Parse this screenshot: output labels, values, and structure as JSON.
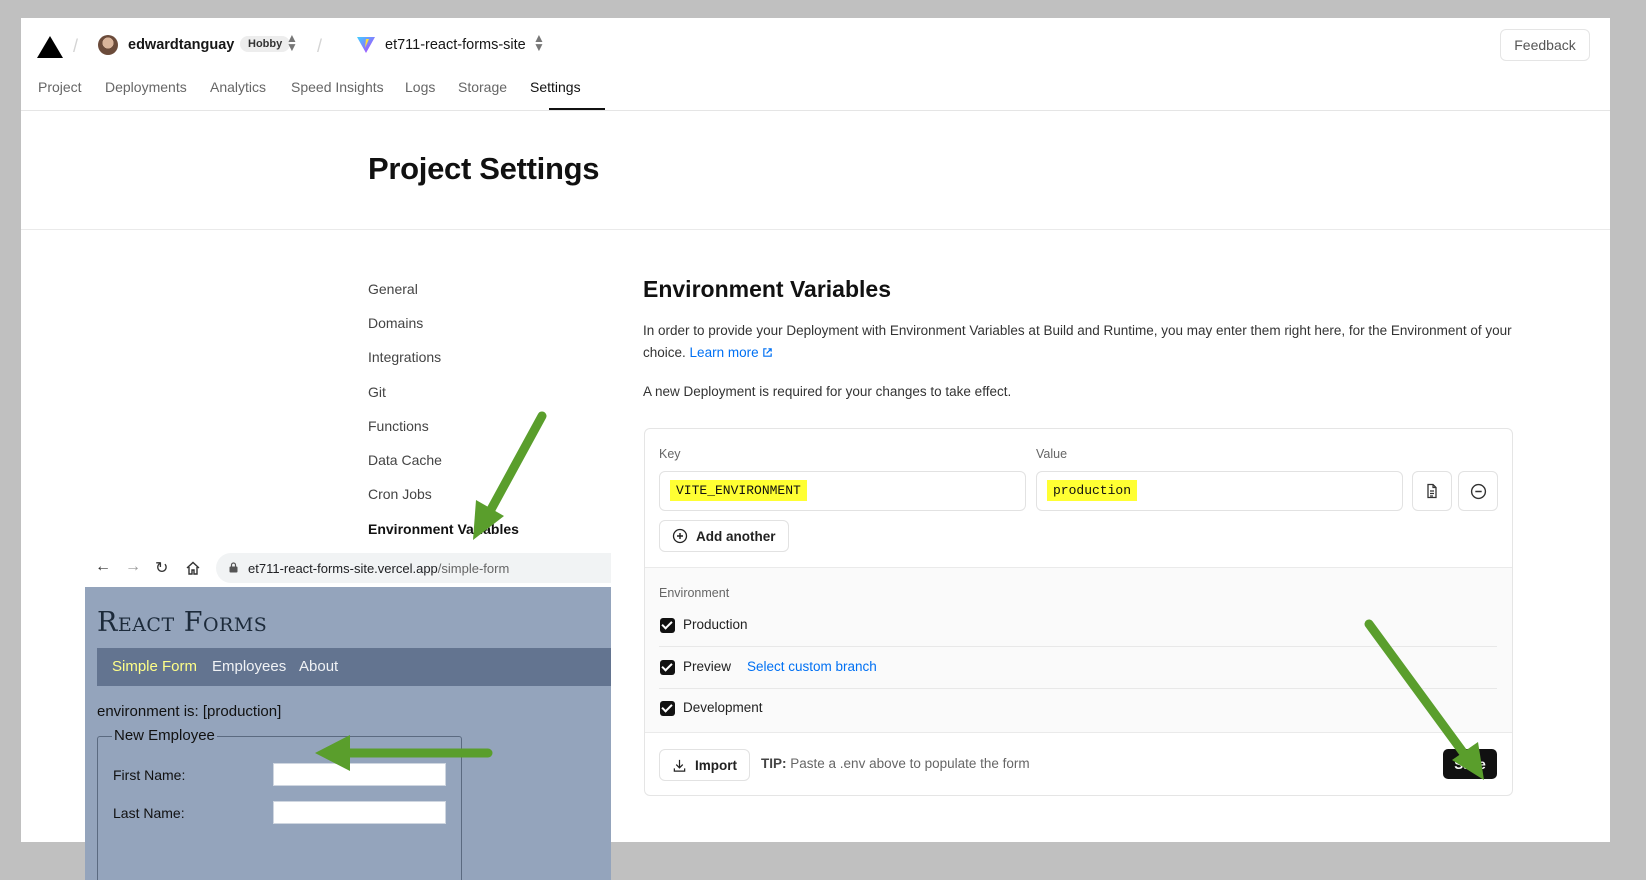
{
  "header": {
    "username": "edwardtanguay",
    "plan_badge": "Hobby",
    "project_name": "et711-react-forms-site",
    "feedback_label": "Feedback"
  },
  "tabs": [
    {
      "label": "Project"
    },
    {
      "label": "Deployments"
    },
    {
      "label": "Analytics"
    },
    {
      "label": "Speed Insights"
    },
    {
      "label": "Logs"
    },
    {
      "label": "Storage"
    },
    {
      "label": "Settings",
      "active": true
    }
  ],
  "page_title": "Project Settings",
  "sidebar": {
    "items": [
      {
        "label": "General"
      },
      {
        "label": "Domains"
      },
      {
        "label": "Integrations"
      },
      {
        "label": "Git"
      },
      {
        "label": "Functions"
      },
      {
        "label": "Data Cache"
      },
      {
        "label": "Cron Jobs"
      },
      {
        "label": "Environment Variables",
        "active": true
      }
    ]
  },
  "env_section": {
    "title": "Environment Variables",
    "description": "In order to provide your Deployment with Environment Variables at Build and Runtime, you may enter them right here, for the Environment of your choice.",
    "learn_more": "Learn more",
    "notice": "A new Deployment is required for your changes to take effect.",
    "key_label": "Key",
    "value_label": "Value",
    "key_value": "VITE_ENVIRONMENT",
    "value_value": "production",
    "add_another": "Add another",
    "environment_label": "Environment",
    "environments": [
      {
        "label": "Production",
        "checked": true
      },
      {
        "label": "Preview",
        "checked": true
      },
      {
        "label": "Development",
        "checked": true
      }
    ],
    "select_custom_branch": "Select custom branch",
    "import_label": "Import",
    "tip_label": "TIP:",
    "tip_text": "Paste a .env above to populate the form",
    "save_label": "Save"
  },
  "browser_overlay": {
    "url_host": "et711-react-forms-site.vercel.app",
    "url_path": "/simple-form",
    "site_title": "React Forms",
    "site_nav": [
      {
        "label": "Simple Form",
        "active": true
      },
      {
        "label": "Employees"
      },
      {
        "label": "About"
      }
    ],
    "env_line": "environment is: [production]",
    "fieldset_legend": "New Employee",
    "first_name_label": "First Name:",
    "last_name_label": "Last Name:"
  },
  "colors": {
    "accent_link": "#0070f3",
    "highlight": "#ffff33",
    "annotation_arrow": "#5a9e2c",
    "site_background": "#94a4bc",
    "site_nav_background": "#637490"
  }
}
